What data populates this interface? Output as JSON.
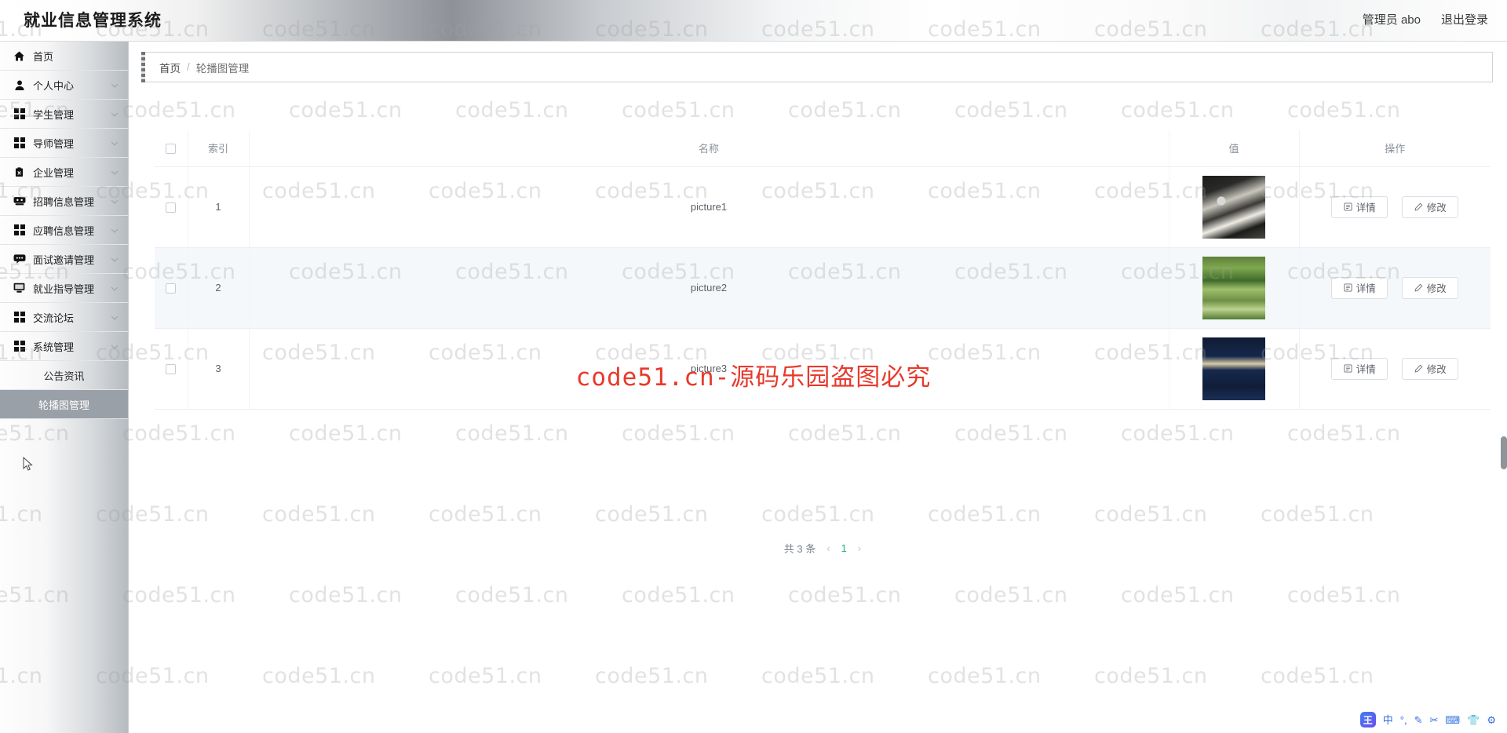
{
  "header": {
    "title": "就业信息管理系统",
    "user_label": "管理员 abo",
    "logout_label": "退出登录"
  },
  "sidebar": {
    "items": [
      {
        "label": "首页",
        "icon": "home-icon",
        "expandable": false
      },
      {
        "label": "个人中心",
        "icon": "user-icon",
        "expandable": true
      },
      {
        "label": "学生管理",
        "icon": "grid-icon",
        "expandable": true
      },
      {
        "label": "导师管理",
        "icon": "grid-icon",
        "expandable": true
      },
      {
        "label": "企业管理",
        "icon": "clipboard-icon",
        "expandable": true
      },
      {
        "label": "招聘信息管理",
        "icon": "archive-icon",
        "expandable": true
      },
      {
        "label": "应聘信息管理",
        "icon": "grid-icon",
        "expandable": true
      },
      {
        "label": "面试邀请管理",
        "icon": "comment-icon",
        "expandable": true
      },
      {
        "label": "就业指导管理",
        "icon": "monitor-icon",
        "expandable": true
      },
      {
        "label": "交流论坛",
        "icon": "grid-icon",
        "expandable": true
      },
      {
        "label": "系统管理",
        "icon": "grid-icon",
        "expandable": true
      }
    ],
    "subitems": [
      {
        "label": "公告资讯",
        "active": false
      },
      {
        "label": "轮播图管理",
        "active": true
      }
    ]
  },
  "breadcrumb": {
    "home": "首页",
    "separator": "/",
    "current": "轮播图管理"
  },
  "table": {
    "columns": [
      "",
      "索引",
      "名称",
      "值",
      "操作"
    ],
    "rows": [
      {
        "index": "1",
        "name": "picture1",
        "thumb": "chess-image",
        "detail_label": "详情",
        "edit_label": "修改"
      },
      {
        "index": "2",
        "name": "picture2",
        "thumb": "park-image",
        "detail_label": "详情",
        "edit_label": "修改"
      },
      {
        "index": "3",
        "name": "picture3",
        "thumb": "dark-poster-image",
        "detail_label": "详情",
        "edit_label": "修改"
      }
    ]
  },
  "pagination": {
    "total_label": "共 3 条",
    "prev": "‹",
    "page": "1",
    "next": "›"
  },
  "watermark": {
    "text": "code51.cn",
    "center_text": "code51.cn-源码乐园盗图必究"
  },
  "ime": {
    "logo": "王",
    "items": [
      "中",
      "°,",
      "pen-icon",
      "scissors-icon",
      "keyboard-icon",
      "skin-icon",
      "gear-icon"
    ],
    "glyphs": [
      "中",
      "°,",
      "✎",
      "✂",
      "⌨",
      "👕",
      "⚙"
    ]
  },
  "colors": {
    "accent_green": "#21b07a",
    "watermark_red": "#e8392c",
    "sidebar_active": "#9aa0a8"
  }
}
